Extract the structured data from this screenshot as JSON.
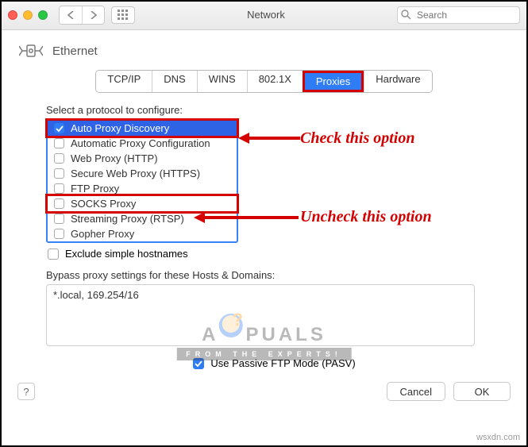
{
  "window": {
    "title": "Network",
    "search_placeholder": "Search"
  },
  "header": {
    "name": "Ethernet"
  },
  "tabs": [
    "TCP/IP",
    "DNS",
    "WINS",
    "802.1X",
    "Proxies",
    "Hardware"
  ],
  "proxies": {
    "label": "Select a protocol to configure:",
    "items": [
      "Auto Proxy Discovery",
      "Automatic Proxy Configuration",
      "Web Proxy (HTTP)",
      "Secure Web Proxy (HTTPS)",
      "FTP Proxy",
      "SOCKS Proxy",
      "Streaming Proxy (RTSP)",
      "Gopher Proxy"
    ],
    "exclude_label": "Exclude simple hostnames",
    "bypass_label": "Bypass proxy settings for these Hosts & Domains:",
    "bypass_value": "*.local, 169.254/16",
    "pasv_label": "Use Passive FTP Mode (PASV)"
  },
  "buttons": {
    "cancel": "Cancel",
    "ok": "OK",
    "help": "?"
  },
  "annotations": {
    "check": "Check this option",
    "uncheck": "Uncheck this option"
  },
  "watermark": {
    "title_left": "A",
    "title_right": "PUALS",
    "sub": "FROM THE EXPERTS!"
  },
  "credit": "wsxdn.com"
}
